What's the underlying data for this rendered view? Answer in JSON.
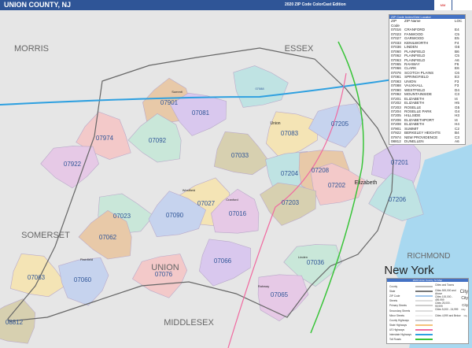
{
  "header": {
    "title": "UNION COUNTY, NJ",
    "edition": "2020 ZIP Code ColorCast Edition",
    "logo": "MARKET MAPS",
    "colors": {
      "bar": "#2f5597"
    }
  },
  "map": {
    "regions": [
      "MORRIS",
      "ESSEX",
      "SOMERSET",
      "UNION",
      "MIDDLESEX",
      "RICHMOND",
      "New York"
    ],
    "cities": [
      "Elizabeth",
      "Union",
      "Westfield",
      "Plainfield",
      "Linden",
      "Rahway",
      "Cranford",
      "Summit"
    ],
    "zip_labels": [
      "07901",
      "07081",
      "07974",
      "07092",
      "07083",
      "07205",
      "07922",
      "07033",
      "07204",
      "07208",
      "07201",
      "07202",
      "07023",
      "07027",
      "07090",
      "07016",
      "07203",
      "07206",
      "07062",
      "07066",
      "07076",
      "07036",
      "07063",
      "07060",
      "07065",
      "08812",
      "07088"
    ],
    "colors": {
      "outside": "#e6e6e6",
      "water": "#a8d8f0",
      "interstate": "#2ea0e0",
      "toll": "#39c439",
      "us_highway": "#f06aa0",
      "state_highway": "#f5c27a"
    }
  },
  "zip_table": {
    "title": "ZIP Code Index/Grid Locator",
    "headers": [
      "ZIP Code",
      "ZIP Name",
      "LOC"
    ],
    "rows": [
      [
        "07016",
        "CRANFORD",
        "E4"
      ],
      [
        "07023",
        "FANWOOD",
        "C5"
      ],
      [
        "07027",
        "GARWOOD",
        "E5"
      ],
      [
        "07033",
        "KENILWORTH",
        "F4"
      ],
      [
        "07036",
        "LINDEN",
        "G6"
      ],
      [
        "07060",
        "PLAINFIELD",
        "B6"
      ],
      [
        "07062",
        "PLAINFIELD",
        "C5"
      ],
      [
        "07063",
        "PLAINFIELD",
        "A6"
      ],
      [
        "07065",
        "RAHWAY",
        "F6"
      ],
      [
        "07066",
        "CLARK",
        "E6"
      ],
      [
        "07076",
        "SCOTCH PLAINS",
        "C6"
      ],
      [
        "07081",
        "SPRINGFIELD",
        "E3"
      ],
      [
        "07083",
        "UNION",
        "F3"
      ],
      [
        "07088",
        "VAUXHALL",
        "F3"
      ],
      [
        "07090",
        "WESTFIELD",
        "D4"
      ],
      [
        "07092",
        "MOUNTAINSIDE",
        "C3"
      ],
      [
        "07201",
        "ELIZABETH",
        "I4"
      ],
      [
        "07202",
        "ELIZABETH",
        "H5"
      ],
      [
        "07203",
        "ROSELLE",
        "G5"
      ],
      [
        "07204",
        "ROSELLE PARK",
        "G4"
      ],
      [
        "07205",
        "HILLSIDE",
        "H3"
      ],
      [
        "07206",
        "ELIZABETHPORT",
        "I4"
      ],
      [
        "07208",
        "ELIZABETH",
        "H4"
      ],
      [
        "07901",
        "SUMMIT",
        "C2"
      ],
      [
        "07922",
        "BERKELEY HEIGHTS",
        "B4"
      ],
      [
        "07974",
        "NEW PROVIDENCE",
        "C3"
      ],
      [
        "08812",
        "DUNELLEN",
        "A6"
      ]
    ]
  },
  "legend": {
    "title": "2020 Union County, NJ Map",
    "items": [
      "County",
      "State",
      "ZIP Code",
      "Streets",
      "Primary Streets",
      "Secondary Streets",
      "Minor Streets",
      "County Highways",
      "State Highways",
      "US Highways",
      "Interstate Highways",
      "Toll Roads"
    ],
    "item_colors": [
      "#bbb",
      "#777",
      "#9ec3ea",
      "#ddd",
      "#ccc",
      "#ddd",
      "#eee",
      "#ccc",
      "#f5c27a",
      "#f06aa0",
      "#2ea0e0",
      "#39c439"
    ],
    "city_header": "Cities and Towns",
    "city_sizes": [
      "Cities 500,000 and Above",
      "Cities 100,000 - 499,999",
      "Cities 25,000 - 99,999",
      "Cities 5,000 - 24,999",
      "Cities 4,999 and Below"
    ],
    "city_sample": "City"
  }
}
